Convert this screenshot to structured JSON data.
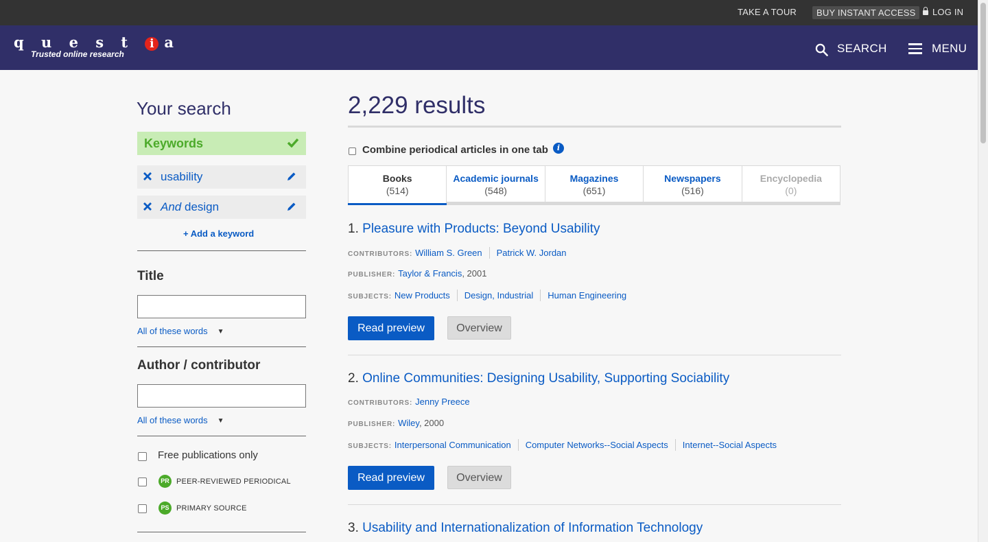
{
  "utility_bar": {
    "tour": "TAKE A TOUR",
    "buy": "BUY INSTANT ACCESS",
    "login": "LOG IN"
  },
  "header": {
    "logo_letters": "questia",
    "logo_pre": "q u e s t",
    "logo_i": "i",
    "logo_post": "a",
    "tagline": "Trusted online research",
    "search_label": "SEARCH",
    "menu_label": "MENU"
  },
  "sidebar": {
    "title": "Your search",
    "keywords_label": "Keywords",
    "keywords": [
      {
        "connector": "",
        "term": "usability"
      },
      {
        "connector": "And",
        "term": "design"
      }
    ],
    "add_keyword": "+ Add a keyword",
    "title_facet": {
      "heading": "Title",
      "value": "",
      "mode": "All of these words"
    },
    "author_facet": {
      "heading": "Author / contributor",
      "value": "",
      "mode": "All of these words"
    },
    "free_only": "Free publications only",
    "peer_reviewed": {
      "badge": "PR",
      "label": "PEER-REVIEWED PERIODICAL"
    },
    "primary_source": {
      "badge": "PS",
      "label": "PRIMARY SOURCE"
    }
  },
  "results": {
    "count_text": "2,229 results",
    "combine_label": "Combine periodical articles in one tab",
    "tabs": [
      {
        "label": "Books",
        "count": "(514)"
      },
      {
        "label": "Academic journals",
        "count": "(548)"
      },
      {
        "label": "Magazines",
        "count": "(651)"
      },
      {
        "label": "Newspapers",
        "count": "(516)"
      },
      {
        "label": "Encyclopedia",
        "count": "(0)"
      }
    ],
    "items": [
      {
        "number": "1.",
        "title": "Pleasure with Products: Beyond Usability",
        "contributors_key": "CONTRIBUTORS:",
        "contributors": [
          "William S. Green",
          "Patrick W. Jordan"
        ],
        "publisher_key": "PUBLISHER:",
        "publisher": "Taylor & Francis",
        "year": ", 2001",
        "subjects_key": "SUBJECTS:",
        "subjects": [
          "New Products",
          "Design, Industrial",
          "Human Engineering"
        ]
      },
      {
        "number": "2.",
        "title": "Online Communities: Designing Usability, Supporting Sociability",
        "contributors_key": "CONTRIBUTORS:",
        "contributors": [
          "Jenny Preece"
        ],
        "publisher_key": "PUBLISHER:",
        "publisher": "Wiley",
        "year": ", 2000",
        "subjects_key": "SUBJECTS:",
        "subjects": [
          "Interpersonal Communication",
          "Computer Networks--Social Aspects",
          "Internet--Social Aspects"
        ]
      },
      {
        "number": "3.",
        "title": "Usability and Internationalization of Information Technology"
      }
    ],
    "read_preview": "Read preview",
    "overview": "Overview"
  },
  "colors": {
    "header_bg": "#302f68",
    "utility_bg": "#333333",
    "link": "#0a5bc4",
    "keyword_green": "#4caa2a",
    "logo_red": "#e3241b"
  }
}
